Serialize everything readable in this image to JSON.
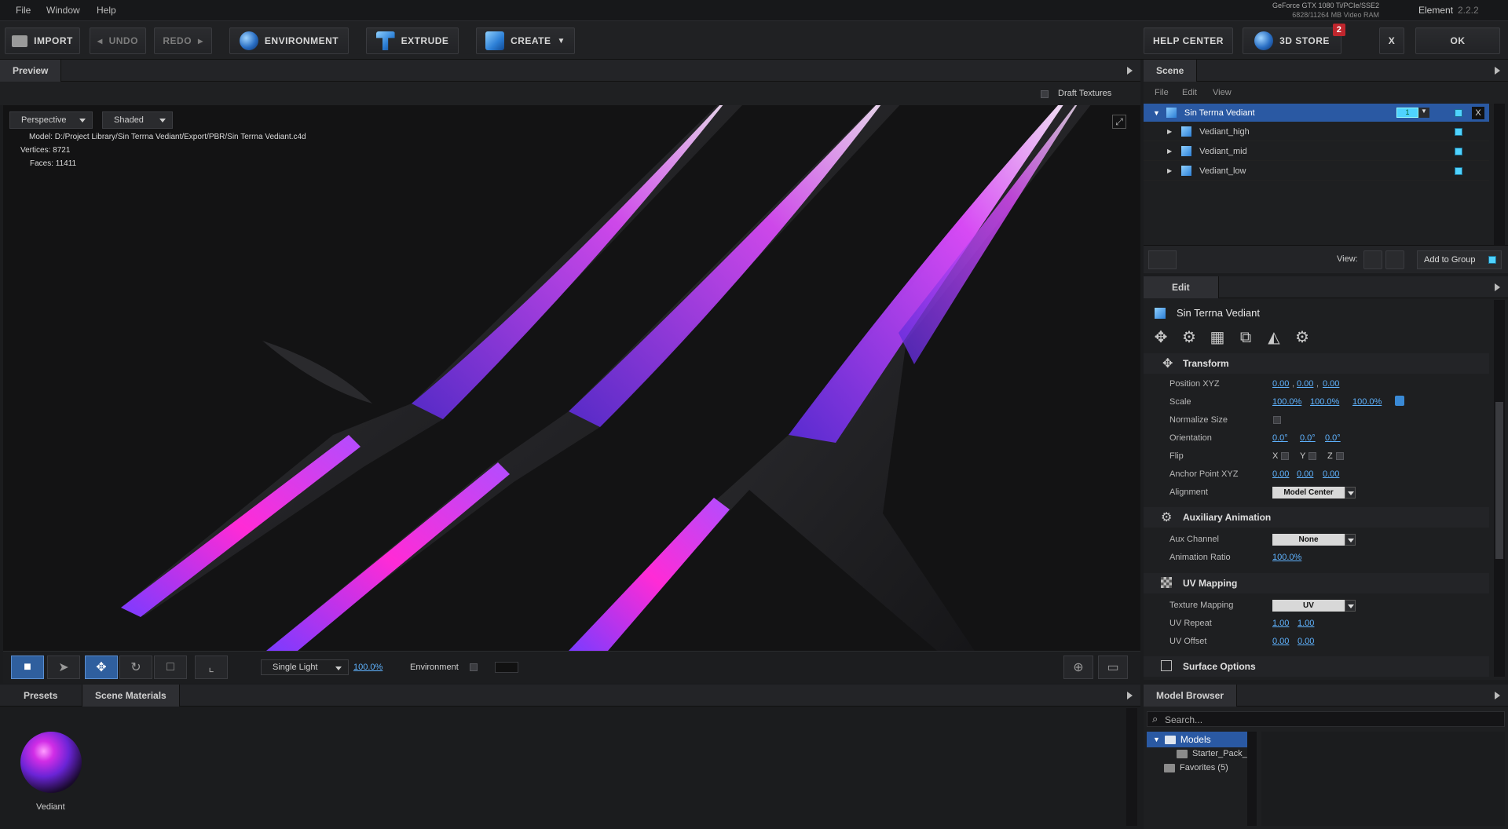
{
  "menubar": {
    "items": [
      "File",
      "Window",
      "Help"
    ],
    "gpu_name": "GeForce GTX 1080 Ti/PCIe/SSE2",
    "gpu_ram": "6828/11264 MB Video RAM",
    "app_name": "Element",
    "app_version": "2.2.2"
  },
  "toolbar": {
    "import": "IMPORT",
    "undo": "UNDO",
    "redo": "REDO",
    "environment": "ENVIRONMENT",
    "extrude": "EXTRUDE",
    "create": "CREATE",
    "help_center": "HELP CENTER",
    "store": "3D STORE",
    "store_badge": "2",
    "close": "X",
    "ok": "OK"
  },
  "preview": {
    "tab": "Preview",
    "draft_textures": "Draft Textures",
    "view_mode": "Perspective",
    "shading": "Shaded",
    "model_label": "Model:",
    "model_path": "D:/Project Library/Sin Terrna Vediant/Export/PBR/Sin Terrna Vediant.c4d",
    "vertices_label": "Vertices:",
    "vertices": "8721",
    "faces_label": "Faces:",
    "faces": "11411",
    "light_mode": "Single Light",
    "light_intensity": "100.0%",
    "environment_label": "Environment"
  },
  "scene": {
    "tab": "Scene",
    "menu": [
      "File",
      "Edit",
      "View"
    ],
    "root": "Sin Terrna Vediant",
    "root_badge": "1",
    "children": [
      "Vediant_high",
      "Vediant_mid",
      "Vediant_low"
    ],
    "view_label": "View:",
    "add_to_group": "Add to Group"
  },
  "edit": {
    "tab": "Edit",
    "object_name": "Sin Terrna Vediant",
    "transform": {
      "title": "Transform",
      "position_label": "Position XYZ",
      "position": [
        "0.00",
        "0.00",
        "0.00"
      ],
      "scale_label": "Scale",
      "scale": [
        "100.0%",
        "100.0%",
        "100.0%"
      ],
      "normalize_label": "Normalize Size",
      "orientation_label": "Orientation",
      "orientation": [
        "0.0°",
        "0.0°",
        "0.0°"
      ],
      "flip_label": "Flip",
      "flip_axes": [
        "X",
        "Y",
        "Z"
      ],
      "anchor_label": "Anchor Point XYZ",
      "anchor": [
        "0.00",
        "0.00",
        "0.00"
      ],
      "alignment_label": "Alignment",
      "alignment": "Model Center"
    },
    "aux": {
      "title": "Auxiliary Animation",
      "channel_label": "Aux Channel",
      "channel": "None",
      "ratio_label": "Animation Ratio",
      "ratio": "100.0%"
    },
    "uv": {
      "title": "UV Mapping",
      "mapping_label": "Texture Mapping",
      "mapping": "UV",
      "repeat_label": "UV Repeat",
      "repeat": [
        "1.00",
        "1.00"
      ],
      "offset_label": "UV Offset",
      "offset": [
        "0.00",
        "0.00"
      ]
    },
    "surface": {
      "title": "Surface Options"
    }
  },
  "presets": {
    "tabs": [
      "Presets",
      "Scene Materials"
    ],
    "material_name": "Vediant"
  },
  "model_browser": {
    "tab": "Model Browser",
    "search_placeholder": "Search...",
    "root": "Models",
    "child": "Starter_Pack_",
    "favorites": "Favorites (5)"
  },
  "colors": {
    "accent_blue": "#2a59a3",
    "link_blue": "#5fb3ff",
    "blade_glow": "#ff2bd6",
    "blade_violet": "#7a3bff"
  }
}
